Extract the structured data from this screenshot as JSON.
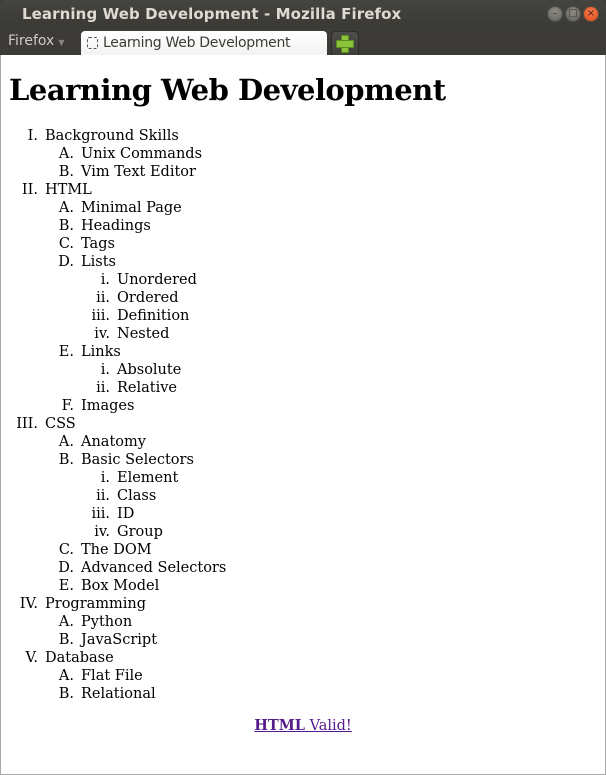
{
  "window": {
    "title": "Learning Web Development - Mozilla Firefox",
    "controls": [
      "minimize",
      "maximize",
      "close"
    ]
  },
  "tabbar": {
    "app_menu_label": "Firefox",
    "tabs": [
      {
        "label": "Learning Web Development",
        "active": true
      }
    ],
    "new_tab_icon": "plus-icon"
  },
  "page": {
    "heading": "Learning Web Development",
    "outline": [
      {
        "marker": "I.",
        "label": "Background Skills",
        "children": [
          {
            "marker": "A.",
            "label": "Unix Commands"
          },
          {
            "marker": "B.",
            "label": "Vim Text Editor"
          }
        ]
      },
      {
        "marker": "II.",
        "label": "HTML",
        "children": [
          {
            "marker": "A.",
            "label": "Minimal Page"
          },
          {
            "marker": "B.",
            "label": "Headings"
          },
          {
            "marker": "C.",
            "label": "Tags"
          },
          {
            "marker": "D.",
            "label": "Lists",
            "children": [
              {
                "marker": "i.",
                "label": "Unordered"
              },
              {
                "marker": "ii.",
                "label": "Ordered"
              },
              {
                "marker": "iii.",
                "label": "Definition"
              },
              {
                "marker": "iv.",
                "label": "Nested"
              }
            ]
          },
          {
            "marker": "E.",
            "label": "Links",
            "children": [
              {
                "marker": "i.",
                "label": "Absolute"
              },
              {
                "marker": "ii.",
                "label": "Relative"
              }
            ]
          },
          {
            "marker": "F.",
            "label": "Images"
          }
        ]
      },
      {
        "marker": "III.",
        "label": "CSS",
        "children": [
          {
            "marker": "A.",
            "label": "Anatomy"
          },
          {
            "marker": "B.",
            "label": "Basic Selectors",
            "children": [
              {
                "marker": "i.",
                "label": "Element"
              },
              {
                "marker": "ii.",
                "label": "Class"
              },
              {
                "marker": "iii.",
                "label": "ID"
              },
              {
                "marker": "iv.",
                "label": "Group"
              }
            ]
          },
          {
            "marker": "C.",
            "label": "The DOM"
          },
          {
            "marker": "D.",
            "label": "Advanced Selectors"
          },
          {
            "marker": "E.",
            "label": "Box Model"
          }
        ]
      },
      {
        "marker": "IV.",
        "label": "Programming",
        "children": [
          {
            "marker": "A.",
            "label": "Python"
          },
          {
            "marker": "B.",
            "label": "JavaScript"
          }
        ]
      },
      {
        "marker": "V.",
        "label": "Database",
        "children": [
          {
            "marker": "A.",
            "label": "Flat File"
          },
          {
            "marker": "B.",
            "label": "Relational"
          }
        ]
      }
    ],
    "footer": {
      "link_bold": "HTML",
      "link_rest": " Valid!",
      "link_color": "#551a8b"
    }
  }
}
